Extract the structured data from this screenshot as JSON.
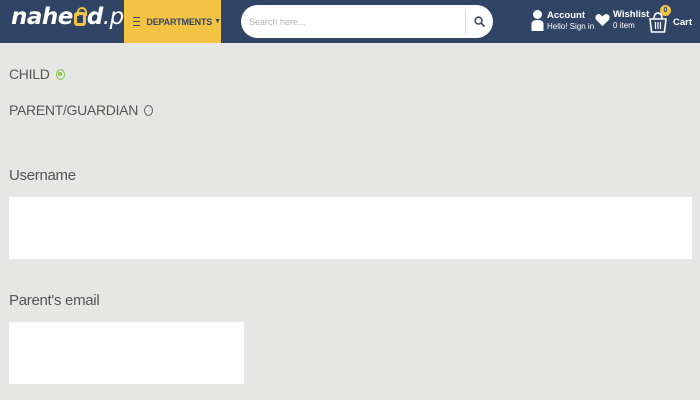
{
  "header": {
    "logo": {
      "part1": "nahe",
      "part2": "d",
      "suffix": ".pk"
    },
    "departments_label": "DEPARTMENTS",
    "search": {
      "placeholder": "Search here...",
      "value": ""
    },
    "account": {
      "title": "Account",
      "subtitle": "Hello! Sign in"
    },
    "wishlist": {
      "title": "Wishlist",
      "subtitle": "0 item"
    },
    "cart": {
      "label": "Cart",
      "count": "0"
    },
    "colors": {
      "bar": "#304466",
      "accent": "#f3c344"
    }
  },
  "form": {
    "radios": [
      {
        "label": "CHILD",
        "checked": true
      },
      {
        "label": "PARENT/GUARDIAN",
        "checked": false
      }
    ],
    "username": {
      "label": "Username",
      "value": ""
    },
    "parent_email": {
      "label": "Parent's email",
      "value": ""
    }
  },
  "colors": {
    "page_bg": "#e6e7e4",
    "radio_checked": "#8bc34a"
  }
}
